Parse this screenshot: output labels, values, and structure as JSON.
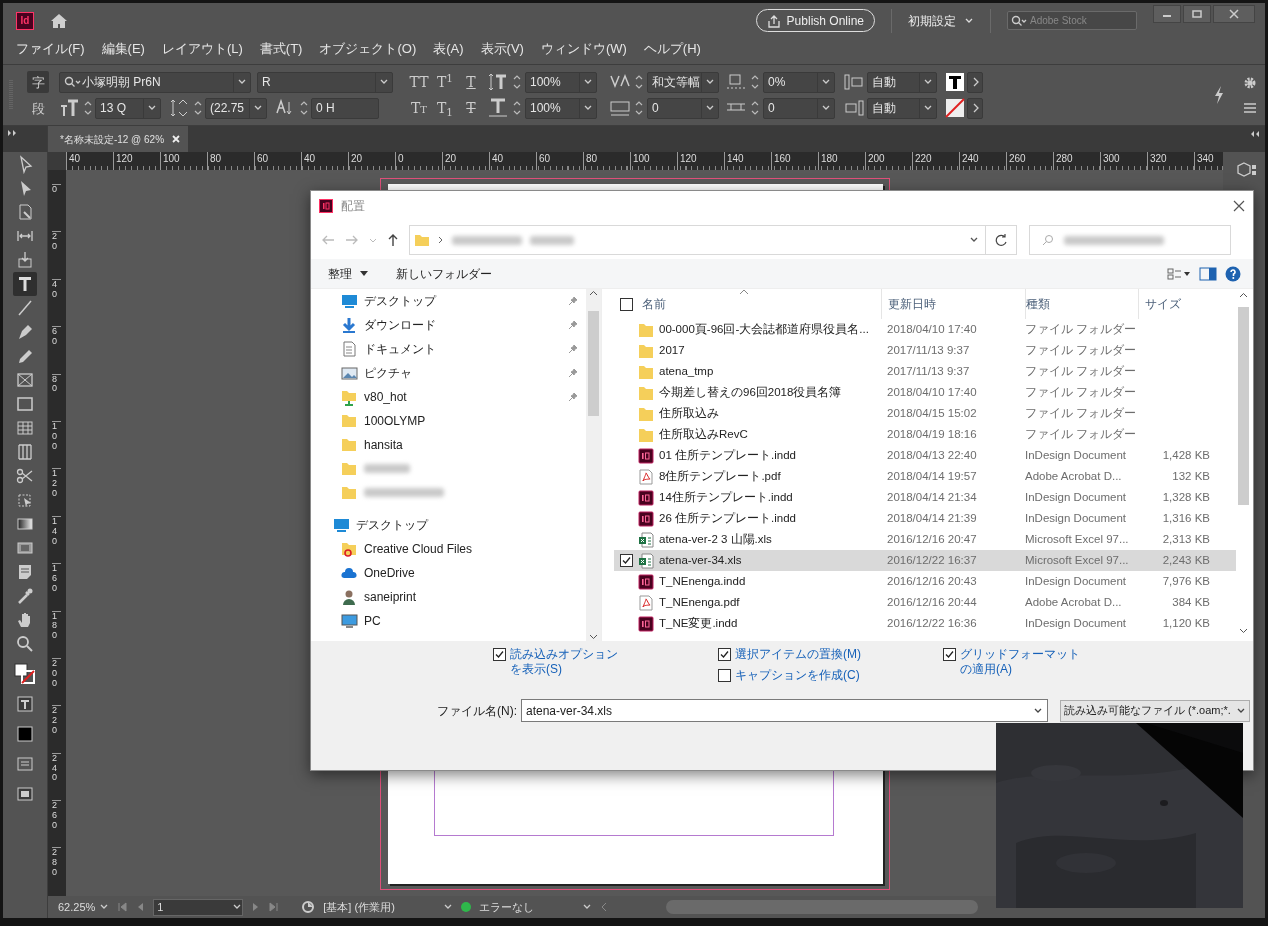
{
  "app": {
    "logo": "Id",
    "publish_button": "Publish Online",
    "workspace": "初期設定",
    "search": {
      "placeholder": "Adobe Stock"
    }
  },
  "menu": [
    "ファイル(F)",
    "編集(E)",
    "レイアウト(L)",
    "書式(T)",
    "オブジェクト(O)",
    "表(A)",
    "表示(V)",
    "ウィンドウ(W)",
    "ヘルプ(H)"
  ],
  "control_panel": {
    "modes": [
      {
        "label": "字",
        "selected": true
      },
      {
        "label": "段",
        "selected": false
      }
    ],
    "rows": [
      [
        {
          "kind": "group",
          "items": [
            {
              "kind": "font",
              "value": "小塚明朝 Pr6N"
            },
            {
              "kind": "combo",
              "value": "R"
            }
          ]
        },
        {
          "kind": "style",
          "buttons": [
            {
              "label": "TT",
              "kind": "plain"
            },
            {
              "label": "T$^{1}$",
              "kind": "plain"
            },
            {
              "label": "T",
              "kind": "underline"
            }
          ]
        },
        {
          "kind": "spin",
          "value": "100%"
        },
        {
          "kind": "spin",
          "value": "和文等幅"
        },
        {
          "kind": "spin",
          "value": "0%"
        },
        {
          "kind": "select",
          "value": "自動"
        },
        {
          "kind": "swatch",
          "none": false
        }
      ],
      [
        {
          "kind": "group",
          "items": [
            {
              "kind": "spin",
              "value": "13 Q"
            },
            {
              "kind": "spin",
              "value": "(22.75"
            },
            {
              "kind": "spin-field",
              "value": "0 H"
            }
          ]
        },
        {
          "kind": "style",
          "buttons": [
            {
              "label": "Tt",
              "kind": "small-caps"
            },
            {
              "label": "T$_{1}$",
              "kind": "plain"
            },
            {
              "label": "T",
              "kind": "strike"
            }
          ]
        },
        {
          "kind": "spin",
          "value": "100%"
        },
        {
          "kind": "spin",
          "value": "0"
        },
        {
          "kind": "spin",
          "value": "0"
        },
        {
          "kind": "select",
          "value": "自動"
        },
        {
          "kind": "swatch",
          "none": true
        }
      ]
    ]
  },
  "tabs": [
    {
      "label": "*名称未設定-12 @ 62%",
      "selected": true
    }
  ],
  "tools": [
    {
      "kind": "selection",
      "selected": false
    },
    {
      "kind": "direct",
      "selected": false
    },
    {
      "kind": "page",
      "selected": false
    },
    {
      "kind": "gap",
      "selected": false
    },
    {
      "kind": "collector",
      "selected": false
    },
    {
      "kind": "type",
      "selected": true
    },
    {
      "kind": "line",
      "selected": false
    },
    {
      "kind": "pen",
      "selected": false
    },
    {
      "kind": "pencil",
      "selected": false
    },
    {
      "kind": "frame",
      "selected": false
    },
    {
      "kind": "rectangle",
      "selected": false
    },
    {
      "kind": "table",
      "selected": false
    },
    {
      "kind": "grid",
      "selected": false
    },
    {
      "kind": "scissors",
      "selected": false
    },
    {
      "kind": "transform",
      "selected": false
    },
    {
      "kind": "gradient",
      "selected": false
    },
    {
      "kind": "feather",
      "selected": false
    },
    {
      "kind": "note",
      "selected": false
    },
    {
      "kind": "eyedropper",
      "selected": false
    },
    {
      "kind": "hand",
      "selected": false
    },
    {
      "kind": "zoom",
      "selected": false
    }
  ],
  "rulers": {
    "horizontal": [
      "40",
      "120",
      "100",
      "80",
      "60",
      "40",
      "20",
      "0",
      "20",
      "40",
      "60",
      "80",
      "100",
      "120",
      "140",
      "160",
      "180",
      "200",
      "220",
      "240",
      "260",
      "280",
      "300",
      "320",
      "340"
    ],
    "vertical": [
      "0",
      "20",
      "40",
      "60",
      "80",
      "100",
      "120",
      "140",
      "160",
      "180",
      "200",
      "220",
      "240",
      "260",
      "280"
    ]
  },
  "dialog": {
    "title": "配置",
    "toolbar": {
      "organize": "整理",
      "new_folder": "新しいフォルダー"
    },
    "nav": {
      "quick_access": [
        {
          "kind": "desktop",
          "label": "デスクトップ",
          "pinned": true
        },
        {
          "kind": "download",
          "label": "ダウンロード",
          "pinned": true
        },
        {
          "kind": "documents",
          "label": "ドキュメント",
          "pinned": true
        },
        {
          "kind": "pictures",
          "label": "ピクチャ",
          "pinned": true
        },
        {
          "kind": "netfolder",
          "label": "v80_hot",
          "pinned": true
        },
        {
          "kind": "folder",
          "label": "100OLYMP",
          "pinned": false
        },
        {
          "kind": "folder",
          "label": "hansita",
          "pinned": false
        },
        {
          "kind": "folder",
          "blurred": true,
          "pinned": false
        },
        {
          "kind": "folder",
          "blurred": true,
          "pinned": false
        }
      ],
      "tree": [
        {
          "kind": "desktop",
          "label": "デスクトップ",
          "children": [
            {
              "kind": "cc",
              "label": "Creative Cloud Files"
            },
            {
              "kind": "onedrive",
              "label": "OneDrive"
            },
            {
              "kind": "user",
              "label": "saneiprint"
            },
            {
              "kind": "pc",
              "label": "PC"
            }
          ]
        }
      ]
    },
    "select_all": {
      "checked": false
    },
    "columns": [
      "名前",
      "更新日時",
      "種類",
      "サイズ"
    ],
    "files": [
      {
        "kind": "folder",
        "name": "00-000頁-96回-大会誌都道府県役員名...",
        "date": "2018/04/10 17:40",
        "type": "ファイル フォルダー",
        "selected": false
      },
      {
        "kind": "folder",
        "name": "2017",
        "date": "2017/11/13 9:37",
        "type": "ファイル フォルダー",
        "selected": false
      },
      {
        "kind": "folder",
        "name": "atena_tmp",
        "date": "2017/11/13 9:37",
        "type": "ファイル フォルダー",
        "selected": false
      },
      {
        "kind": "folder",
        "name": "今期差し替えの96回2018役員名簿",
        "date": "2018/04/10 17:40",
        "type": "ファイル フォルダー",
        "selected": false
      },
      {
        "kind": "folder",
        "name": "住所取込み",
        "date": "2018/04/15 15:02",
        "type": "ファイル フォルダー",
        "selected": false
      },
      {
        "kind": "folder",
        "name": "住所取込みRevC",
        "date": "2018/04/19 18:16",
        "type": "ファイル フォルダー",
        "selected": false
      },
      {
        "kind": "indd",
        "name": "01 住所テンプレート.indd",
        "date": "2018/04/13 22:40",
        "type": "InDesign Document",
        "size": "1,428 KB",
        "selected": false
      },
      {
        "kind": "pdf",
        "name": "8住所テンプレート.pdf",
        "date": "2018/04/14 19:57",
        "type": "Adobe Acrobat D...",
        "size": "132 KB",
        "selected": false
      },
      {
        "kind": "indd",
        "name": "14住所テンプレート.indd",
        "date": "2018/04/14 21:34",
        "type": "InDesign Document",
        "size": "1,328 KB",
        "selected": false
      },
      {
        "kind": "indd",
        "name": "26 住所テンプレート.indd",
        "date": "2018/04/14 21:39",
        "type": "InDesign Document",
        "size": "1,316 KB",
        "selected": false
      },
      {
        "kind": "xls",
        "name": "atena-ver-2 3 山陽.xls",
        "date": "2016/12/16 20:47",
        "type": "Microsoft Excel 97...",
        "size": "2,313 KB",
        "selected": false
      },
      {
        "kind": "xls",
        "name": "atena-ver-34.xls",
        "date": "2016/12/22 16:37",
        "type": "Microsoft Excel 97...",
        "size": "2,243 KB",
        "selected": true
      },
      {
        "kind": "indd",
        "name": "T_NEnenga.indd",
        "date": "2016/12/16 20:43",
        "type": "InDesign Document",
        "size": "7,976 KB",
        "selected": false
      },
      {
        "kind": "pdf",
        "name": "T_NEnenga.pdf",
        "date": "2016/12/16 20:44",
        "type": "Adobe Acrobat D...",
        "size": "384 KB",
        "selected": false
      },
      {
        "kind": "indd",
        "name": "T_NE変更.indd",
        "date": "2016/12/22 16:36",
        "type": "InDesign Document",
        "size": "1,120 KB",
        "selected": false
      }
    ],
    "options": [
      [
        {
          "label": "読み込みオプションを表示(S)",
          "checked": true
        }
      ],
      [
        {
          "label": "選択アイテムの置換(M)",
          "checked": true
        },
        {
          "label": "キャプションを作成(C)",
          "checked": false
        }
      ],
      [
        {
          "label": "グリッドフォーマットの適用(A)",
          "checked": true
        }
      ]
    ],
    "filename": {
      "label": "ファイル名(N):",
      "value": "atena-ver-34.xls"
    },
    "filter": "読み込み可能なファイル (*.oam;*."
  },
  "status_bar": {
    "zoom": "62.25%",
    "page": "1",
    "profile": "[基本] (作業用)",
    "preflight": {
      "label": "エラーなし",
      "ok": true
    }
  }
}
